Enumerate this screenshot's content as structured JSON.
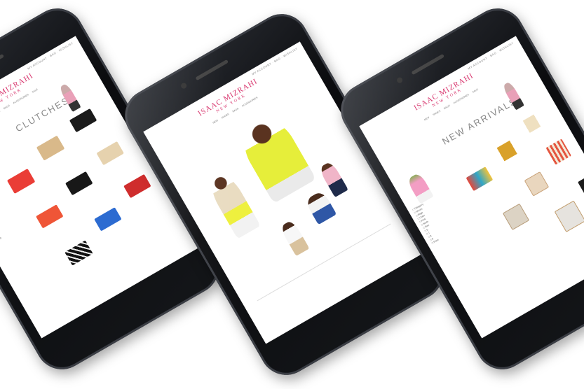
{
  "brand": {
    "name": "ISAAC MIZRAHI",
    "tagline": "NEW YORK"
  },
  "phones": [
    {
      "id": "left",
      "page_title": "CLUTCHES"
    },
    {
      "id": "center",
      "page_title": ""
    },
    {
      "id": "right",
      "page_title": "NEW ARRIVALS"
    }
  ],
  "colors": {
    "brand_pink": "#d8376f",
    "phone_body": "#0b0c0f"
  }
}
